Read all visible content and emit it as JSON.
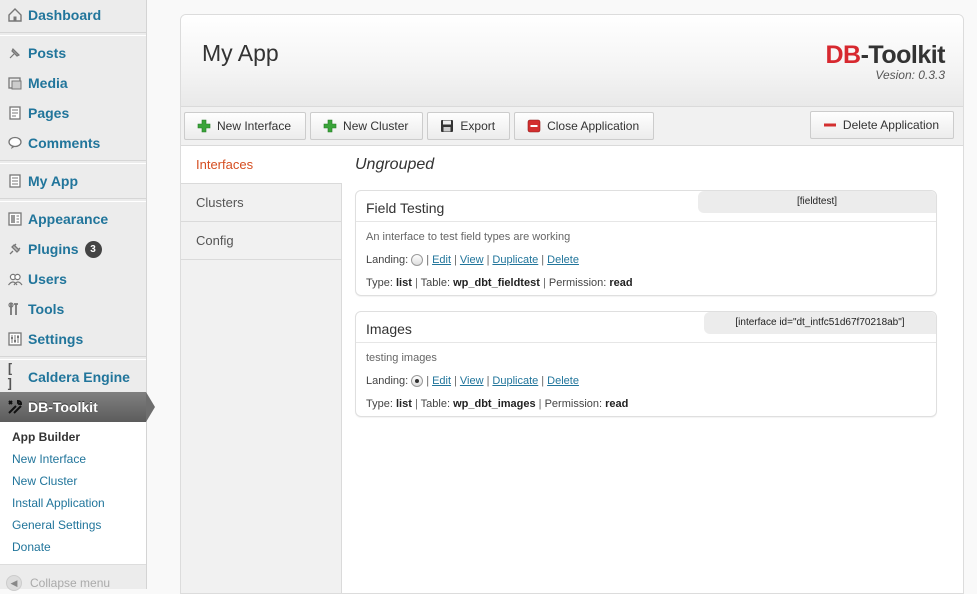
{
  "sidebar": {
    "items": [
      {
        "label": "Dashboard",
        "icon": "dashboard-icon"
      },
      {
        "label": "Posts",
        "icon": "pin-icon"
      },
      {
        "label": "Media",
        "icon": "media-icon"
      },
      {
        "label": "Pages",
        "icon": "pages-icon"
      },
      {
        "label": "Comments",
        "icon": "comment-icon"
      },
      {
        "label": "My App",
        "icon": "app-icon"
      },
      {
        "label": "Appearance",
        "icon": "appearance-icon"
      },
      {
        "label": "Plugins",
        "icon": "plug-icon",
        "badge": "3"
      },
      {
        "label": "Users",
        "icon": "users-icon"
      },
      {
        "label": "Tools",
        "icon": "tools-icon"
      },
      {
        "label": "Settings",
        "icon": "settings-icon"
      },
      {
        "label": "Caldera Engine",
        "icon": "bracket-icon"
      },
      {
        "label": "DB-Toolkit",
        "icon": "wrench-icon"
      }
    ],
    "submenu": [
      "App Builder",
      "New Interface",
      "New Cluster",
      "Install Application",
      "General Settings",
      "Donate"
    ],
    "collapse_label": "Collapse menu"
  },
  "header": {
    "title": "My App",
    "brand_db": "DB",
    "brand_rest": "-Toolkit",
    "version": "Vesion: 0.3.3"
  },
  "toolbar": {
    "new_interface": "New Interface",
    "new_cluster": "New Cluster",
    "export": "Export",
    "close_application": "Close Application",
    "delete_application": "Delete Application"
  },
  "tabs": [
    "Interfaces",
    "Clusters",
    "Config"
  ],
  "group_title": "Ungrouped",
  "interfaces": [
    {
      "title": "Field Testing",
      "shortcode": "[fieldtest]",
      "description": "An interface to test field types are working",
      "landing_label": "Landing:",
      "landing": false,
      "actions": [
        "Edit",
        "View",
        "Duplicate",
        "Delete"
      ],
      "type_label": "Type:",
      "type": "list",
      "table_label": "Table:",
      "table": "wp_dbt_fieldtest",
      "permission_label": "Permission:",
      "permission": "read"
    },
    {
      "title": "Images",
      "shortcode": "[interface id=\"dt_intfc51d67f70218ab\"]",
      "description": "testing images",
      "landing_label": "Landing:",
      "landing": true,
      "actions": [
        "Edit",
        "View",
        "Duplicate",
        "Delete"
      ],
      "type_label": "Type:",
      "type": "list",
      "table_label": "Table:",
      "table": "wp_dbt_images",
      "permission_label": "Permission:",
      "permission": "read"
    }
  ],
  "colors": {
    "link": "#21759b",
    "active_tab": "#d54e21",
    "brand_red": "#d7282f"
  }
}
